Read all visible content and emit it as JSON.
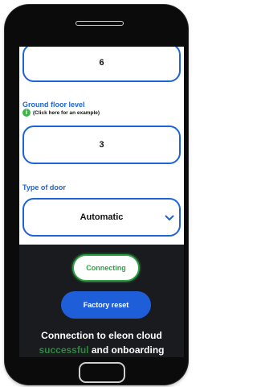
{
  "form": {
    "floors_value": "6",
    "ground_floor": {
      "label": "Ground floor level",
      "hint": "(Click here for an example)",
      "hint_icon": "info-icon",
      "value": "3"
    },
    "door": {
      "label": "Type of door",
      "value": "Automatic",
      "icon": "chevron-down-icon"
    }
  },
  "actions": {
    "connecting_label": "Connecting",
    "factory_reset_label": "Factory reset"
  },
  "status": {
    "line1": "Connection to eleon cloud",
    "line2_highlight": "successful",
    "line2_rest": " and onboarding"
  },
  "colors": {
    "accent_blue": "#1e64d6",
    "success_green": "#2ea043",
    "dark_panel": "#1a1b1f"
  }
}
